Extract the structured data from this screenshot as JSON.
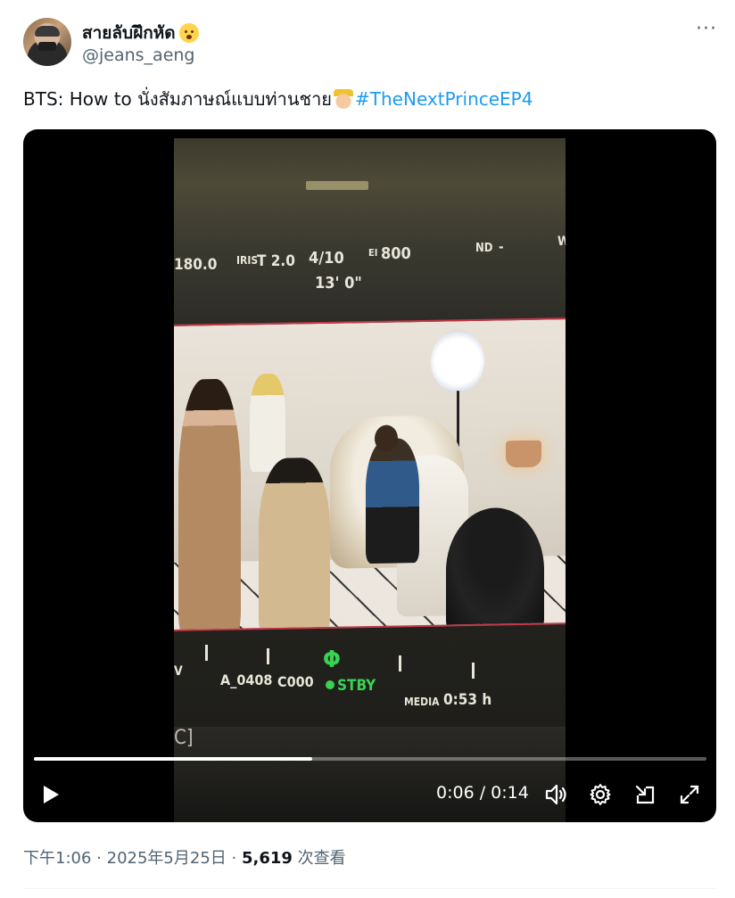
{
  "author": {
    "display_name": "สายลับฝึกหัด",
    "handle": "@jeans_aeng"
  },
  "tweet": {
    "text": "BTS: How to นั่งสัมภาษณ์แบบท่านชาย",
    "hashtag": "#TheNextPrinceEP4"
  },
  "camera_osd": {
    "shutter": "180.0",
    "iris_label": "IRIS",
    "iris_value": "T 2.0",
    "fps": "4/10",
    "ei_label": "EI",
    "ei_value": "800",
    "nd_label": "ND",
    "nd_value": "-",
    "w_label": "W",
    "focus": "13'  0\"",
    "clip": "A_0408",
    "clip_count": "C000",
    "status": "STBY",
    "media_label": "MEDIA",
    "media_value": "0:53 h",
    "left_fragment": "V",
    "device_label": "C]"
  },
  "player": {
    "current_time": "0:06",
    "separator": "/",
    "duration": "0:14",
    "progress": 0.414
  },
  "meta": {
    "time": "下午1:06",
    "date": "2025年5月25日",
    "views": "5,619",
    "views_label": "次查看"
  },
  "colors": {
    "hashtag": "#1d9bf0",
    "secondary_text": "#536471",
    "record_green": "#39d353",
    "frame_line": "#c2384a"
  }
}
